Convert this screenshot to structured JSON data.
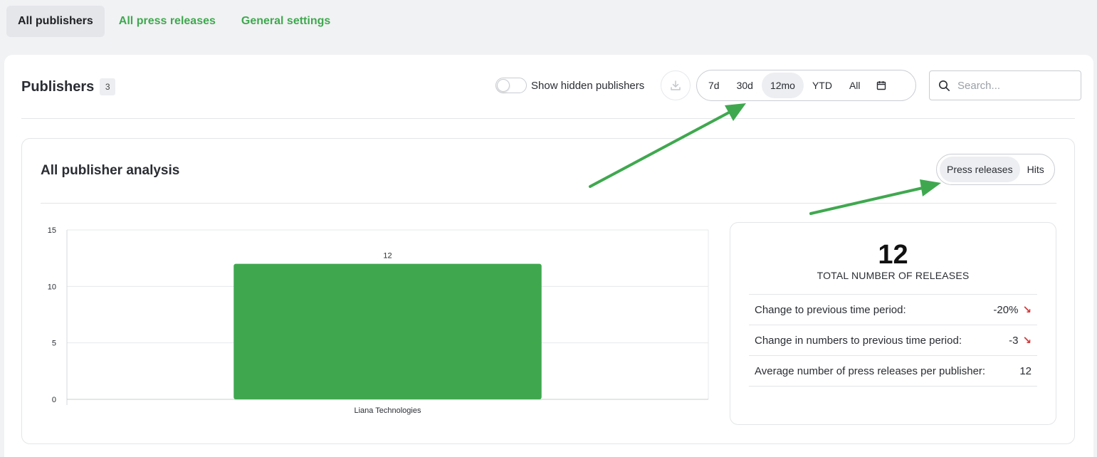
{
  "nav": {
    "tabs": [
      {
        "label": "All publishers"
      },
      {
        "label": "All press releases"
      },
      {
        "label": "General settings"
      }
    ]
  },
  "header": {
    "title": "Publishers",
    "count": "3",
    "toggle_label": "Show hidden publishers",
    "ranges": [
      "7d",
      "30d",
      "12mo",
      "YTD",
      "All"
    ],
    "active_range": "12mo",
    "search_placeholder": "Search..."
  },
  "analysis": {
    "title": "All publisher analysis",
    "segments": [
      "Press releases",
      "Hits"
    ],
    "active_segment": "Press releases"
  },
  "chart_data": {
    "type": "bar",
    "categories": [
      "Liana Technologies"
    ],
    "values": [
      12
    ],
    "ylim": [
      0,
      15
    ],
    "yticks": [
      0,
      5,
      10,
      15
    ],
    "grid": true,
    "bar_color": "#3fa84f",
    "data_labels": [
      "12"
    ]
  },
  "stats": {
    "total": "12",
    "total_label": "TOTAL NUMBER OF RELEASES",
    "rows": [
      {
        "label": "Change to previous time period:",
        "value": "-20%",
        "trend": "down"
      },
      {
        "label": "Change in numbers to previous time period:",
        "value": "-3",
        "trend": "down"
      },
      {
        "label": "Average number of press releases per publisher:",
        "value": "12",
        "trend": ""
      }
    ]
  },
  "colors": {
    "accent": "#3fa84f",
    "negative": "#d23a3a",
    "annotation_arrow": "#3fa84f"
  }
}
